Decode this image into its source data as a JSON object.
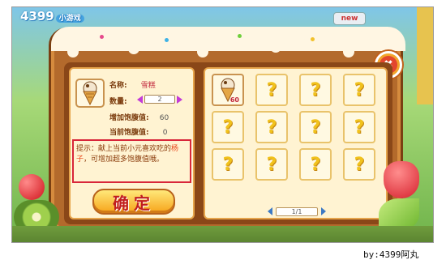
{
  "header": {
    "logo_text": "4399",
    "logo_sub": "小游戏",
    "new_badge": "new"
  },
  "dialog": {
    "item": {
      "icon": "ice-cream-cone-icon",
      "name_label": "名称:",
      "name_value": "雪糕",
      "qty_label": "数量:",
      "qty_value": "2",
      "increase_label": "增加饱腹值:",
      "increase_value": "60",
      "current_label": "当前饱腹值:",
      "current_value": "0"
    },
    "tip": {
      "part1": "提示：献上当前小元喜欢吃的",
      "highlight": "杨子",
      "part2": "，可增加超多饱腹值哦。"
    },
    "confirm_label": "确定",
    "grid": {
      "first_cell_count": "60",
      "placeholder": "?"
    },
    "pager": {
      "label": "1/1"
    }
  },
  "credit": "by:4399阿丸",
  "colors": {
    "panel": "#b36a2c",
    "card": "#fff3d2",
    "tip_border": "#d8263a",
    "confirm": "#f6a319"
  }
}
